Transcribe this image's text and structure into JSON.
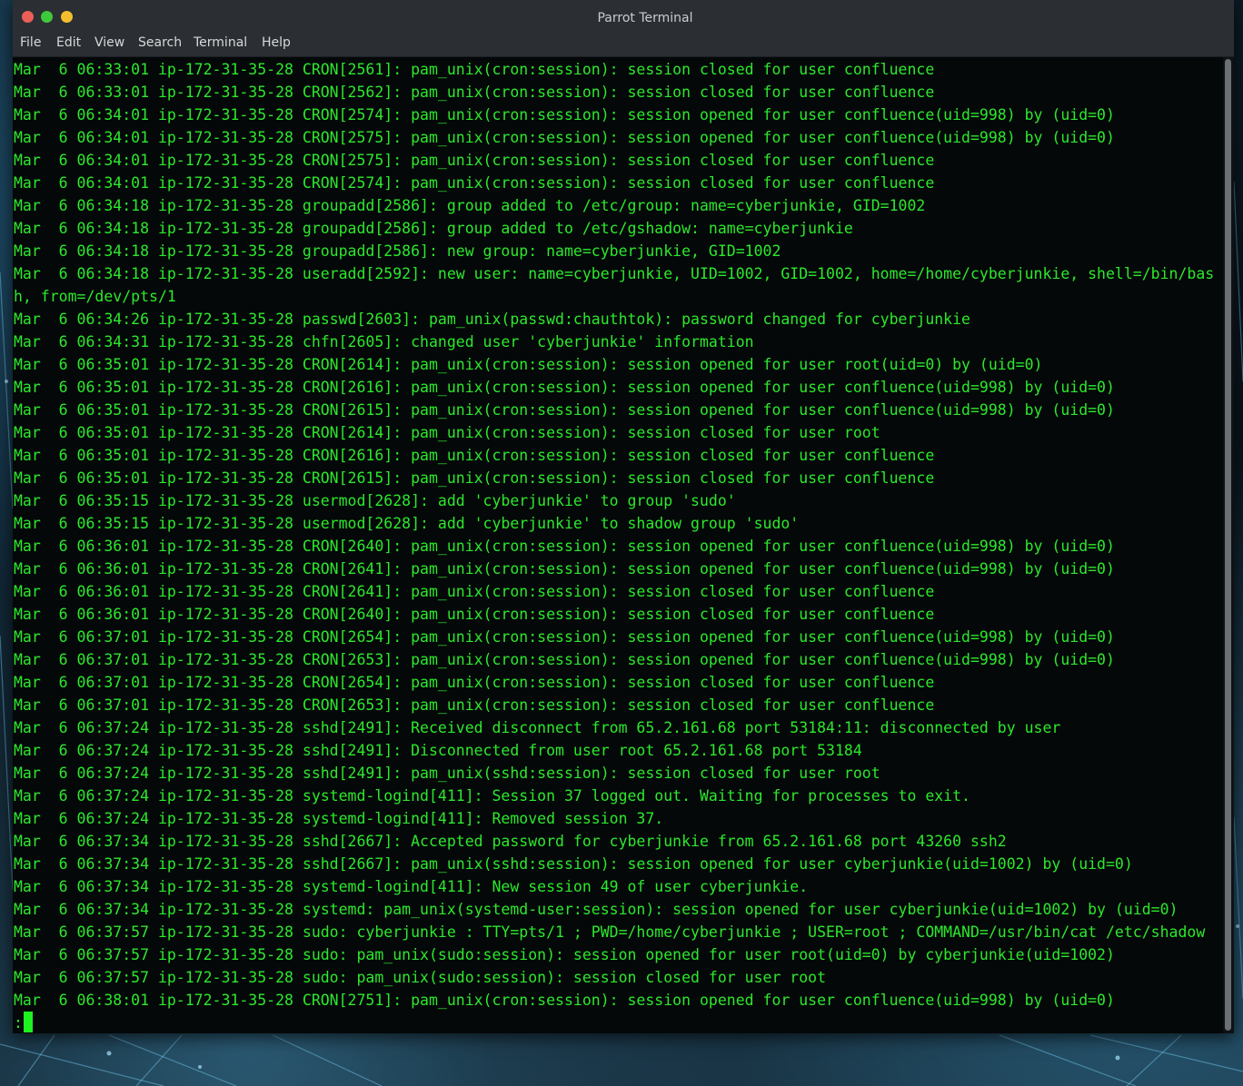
{
  "window": {
    "title": "Parrot Terminal"
  },
  "menu": [
    "File",
    "Edit",
    "View",
    "Search",
    "Terminal",
    "Help"
  ],
  "terminal": {
    "lines": [
      "Mar  6 06:33:01 ip-172-31-35-28 CRON[2561]: pam_unix(cron:session): session closed for user confluence",
      "Mar  6 06:33:01 ip-172-31-35-28 CRON[2562]: pam_unix(cron:session): session closed for user confluence",
      "Mar  6 06:34:01 ip-172-31-35-28 CRON[2574]: pam_unix(cron:session): session opened for user confluence(uid=998) by (uid=0)",
      "Mar  6 06:34:01 ip-172-31-35-28 CRON[2575]: pam_unix(cron:session): session opened for user confluence(uid=998) by (uid=0)",
      "Mar  6 06:34:01 ip-172-31-35-28 CRON[2575]: pam_unix(cron:session): session closed for user confluence",
      "Mar  6 06:34:01 ip-172-31-35-28 CRON[2574]: pam_unix(cron:session): session closed for user confluence",
      "Mar  6 06:34:18 ip-172-31-35-28 groupadd[2586]: group added to /etc/group: name=cyberjunkie, GID=1002",
      "Mar  6 06:34:18 ip-172-31-35-28 groupadd[2586]: group added to /etc/gshadow: name=cyberjunkie",
      "Mar  6 06:34:18 ip-172-31-35-28 groupadd[2586]: new group: name=cyberjunkie, GID=1002",
      "Mar  6 06:34:18 ip-172-31-35-28 useradd[2592]: new user: name=cyberjunkie, UID=1002, GID=1002, home=/home/cyberjunkie, shell=/bin/bas",
      "h, from=/dev/pts/1",
      "Mar  6 06:34:26 ip-172-31-35-28 passwd[2603]: pam_unix(passwd:chauthtok): password changed for cyberjunkie",
      "Mar  6 06:34:31 ip-172-31-35-28 chfn[2605]: changed user 'cyberjunkie' information",
      "Mar  6 06:35:01 ip-172-31-35-28 CRON[2614]: pam_unix(cron:session): session opened for user root(uid=0) by (uid=0)",
      "Mar  6 06:35:01 ip-172-31-35-28 CRON[2616]: pam_unix(cron:session): session opened for user confluence(uid=998) by (uid=0)",
      "Mar  6 06:35:01 ip-172-31-35-28 CRON[2615]: pam_unix(cron:session): session opened for user confluence(uid=998) by (uid=0)",
      "Mar  6 06:35:01 ip-172-31-35-28 CRON[2614]: pam_unix(cron:session): session closed for user root",
      "Mar  6 06:35:01 ip-172-31-35-28 CRON[2616]: pam_unix(cron:session): session closed for user confluence",
      "Mar  6 06:35:01 ip-172-31-35-28 CRON[2615]: pam_unix(cron:session): session closed for user confluence",
      "Mar  6 06:35:15 ip-172-31-35-28 usermod[2628]: add 'cyberjunkie' to group 'sudo'",
      "Mar  6 06:35:15 ip-172-31-35-28 usermod[2628]: add 'cyberjunkie' to shadow group 'sudo'",
      "Mar  6 06:36:01 ip-172-31-35-28 CRON[2640]: pam_unix(cron:session): session opened for user confluence(uid=998) by (uid=0)",
      "Mar  6 06:36:01 ip-172-31-35-28 CRON[2641]: pam_unix(cron:session): session opened for user confluence(uid=998) by (uid=0)",
      "Mar  6 06:36:01 ip-172-31-35-28 CRON[2641]: pam_unix(cron:session): session closed for user confluence",
      "Mar  6 06:36:01 ip-172-31-35-28 CRON[2640]: pam_unix(cron:session): session closed for user confluence",
      "Mar  6 06:37:01 ip-172-31-35-28 CRON[2654]: pam_unix(cron:session): session opened for user confluence(uid=998) by (uid=0)",
      "Mar  6 06:37:01 ip-172-31-35-28 CRON[2653]: pam_unix(cron:session): session opened for user confluence(uid=998) by (uid=0)",
      "Mar  6 06:37:01 ip-172-31-35-28 CRON[2654]: pam_unix(cron:session): session closed for user confluence",
      "Mar  6 06:37:01 ip-172-31-35-28 CRON[2653]: pam_unix(cron:session): session closed for user confluence",
      "Mar  6 06:37:24 ip-172-31-35-28 sshd[2491]: Received disconnect from 65.2.161.68 port 53184:11: disconnected by user",
      "Mar  6 06:37:24 ip-172-31-35-28 sshd[2491]: Disconnected from user root 65.2.161.68 port 53184",
      "Mar  6 06:37:24 ip-172-31-35-28 sshd[2491]: pam_unix(sshd:session): session closed for user root",
      "Mar  6 06:37:24 ip-172-31-35-28 systemd-logind[411]: Session 37 logged out. Waiting for processes to exit.",
      "Mar  6 06:37:24 ip-172-31-35-28 systemd-logind[411]: Removed session 37.",
      "Mar  6 06:37:34 ip-172-31-35-28 sshd[2667]: Accepted password for cyberjunkie from 65.2.161.68 port 43260 ssh2",
      "Mar  6 06:37:34 ip-172-31-35-28 sshd[2667]: pam_unix(sshd:session): session opened for user cyberjunkie(uid=1002) by (uid=0)",
      "Mar  6 06:37:34 ip-172-31-35-28 systemd-logind[411]: New session 49 of user cyberjunkie.",
      "Mar  6 06:37:34 ip-172-31-35-28 systemd: pam_unix(systemd-user:session): session opened for user cyberjunkie(uid=1002) by (uid=0)",
      "Mar  6 06:37:57 ip-172-31-35-28 sudo: cyberjunkie : TTY=pts/1 ; PWD=/home/cyberjunkie ; USER=root ; COMMAND=/usr/bin/cat /etc/shadow",
      "Mar  6 06:37:57 ip-172-31-35-28 sudo: pam_unix(sudo:session): session opened for user root(uid=0) by cyberjunkie(uid=1002)",
      "Mar  6 06:37:57 ip-172-31-35-28 sudo: pam_unix(sudo:session): session closed for user root",
      "Mar  6 06:38:01 ip-172-31-35-28 CRON[2751]: pam_unix(cron:session): session opened for user confluence(uid=998) by (uid=0)"
    ],
    "prompt": ":"
  },
  "colors": {
    "text": "#2ce82c",
    "cursor": "#1ff01f",
    "background": "#050809",
    "titlebar": "#2b2f33",
    "close": "#ec5f57",
    "minimize": "#3ec93a",
    "maximize": "#f4bf2e"
  }
}
